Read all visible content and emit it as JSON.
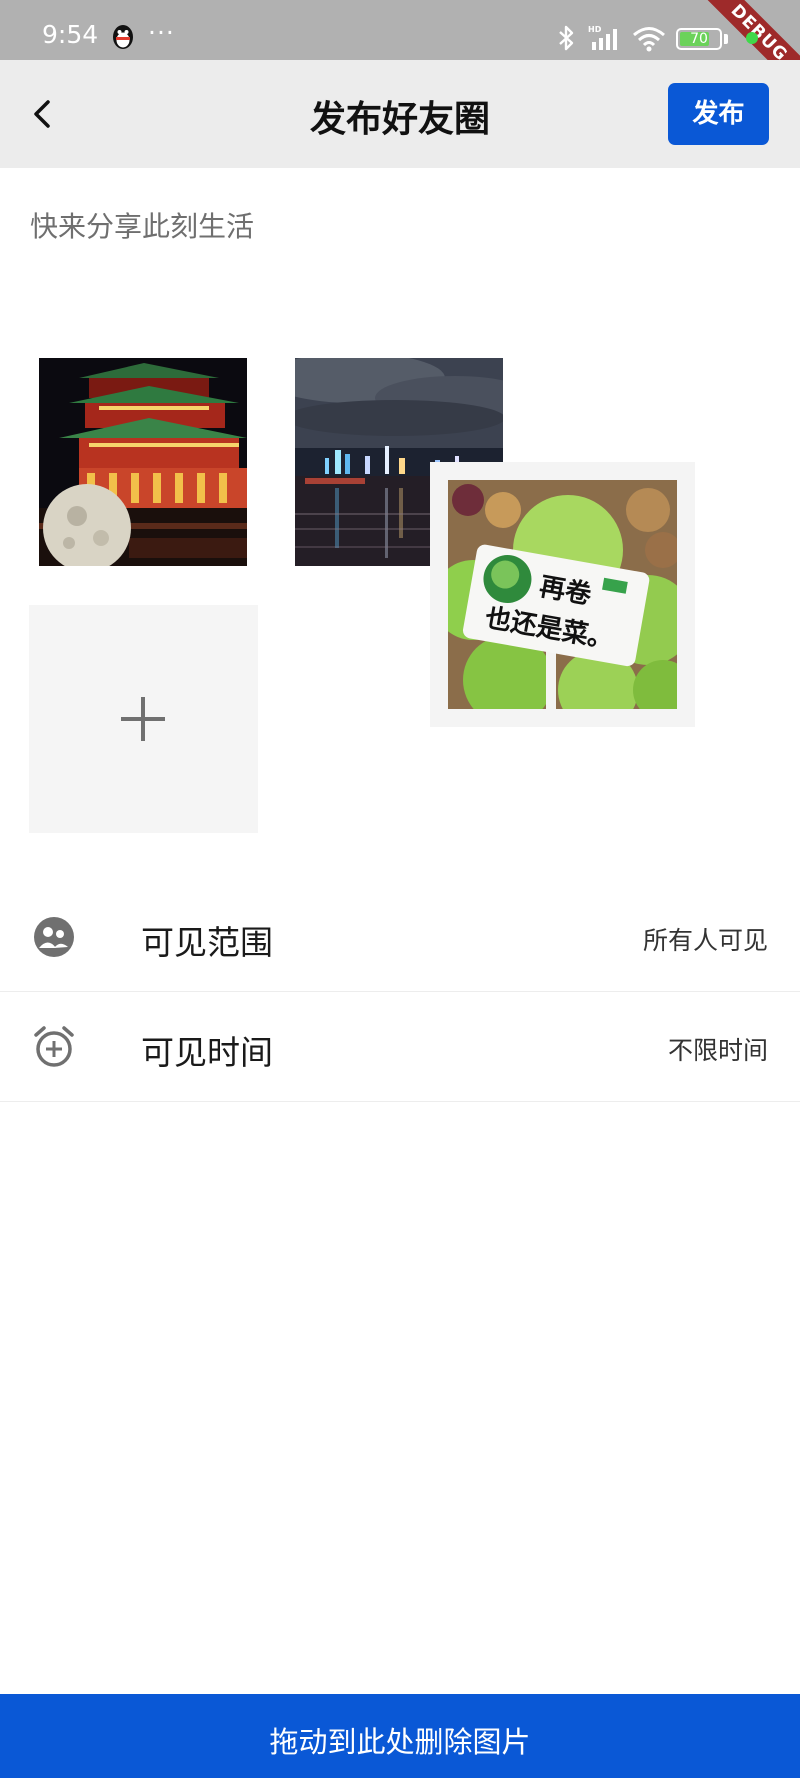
{
  "status_bar": {
    "time": "9:54",
    "dots": "···",
    "battery": "70",
    "debug_label": "DEBUG"
  },
  "header": {
    "title": "发布好友圈",
    "publish_label": "发布"
  },
  "composer": {
    "placeholder": "快来分享此刻生活",
    "value": ""
  },
  "images": [
    {
      "name": "night-pagoda-with-moon"
    },
    {
      "name": "city-skyline-river-night"
    },
    {
      "name": "cabbage-sign",
      "sign_line1": "再卷",
      "sign_line2": "也还是菜。"
    }
  ],
  "settings": [
    {
      "label": "可见范围",
      "value": "所有人可见",
      "icon": "people-icon"
    },
    {
      "label": "可见时间",
      "value": "不限时间",
      "icon": "alarm-add-icon"
    }
  ],
  "delete_zone": {
    "label": "拖动到此处删除图片"
  },
  "colors": {
    "accent": "#0a58d6",
    "appbar_bg": "#ececec",
    "statusbar_bg": "#b1b1b1"
  }
}
